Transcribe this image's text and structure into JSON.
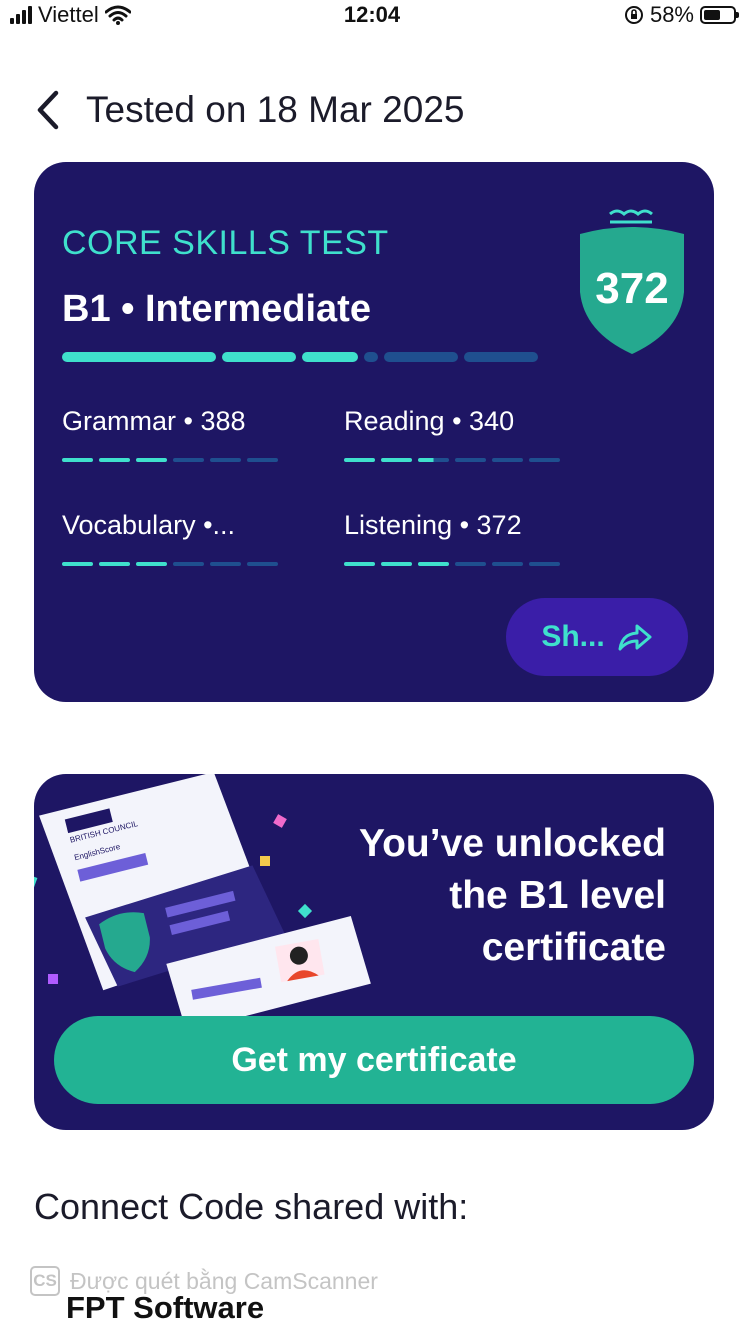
{
  "status_bar": {
    "carrier": "Viettel",
    "time": "12:04",
    "battery_percent": "58%",
    "battery_level": 0.58,
    "icons": [
      "signal-icon",
      "wifi-icon",
      "rotation-lock-icon",
      "battery-icon"
    ]
  },
  "header": {
    "back_icon": "chevron-left-icon",
    "title": "Tested on 18 Mar 2025"
  },
  "result_card": {
    "test_name": "CORE SKILLS TEST",
    "level": "B1 • Intermediate",
    "overall_score": "372",
    "progress_segments_filled": 3,
    "progress_segments_total": 6,
    "skills": [
      {
        "label": "Grammar • 388",
        "segments_filled": 3,
        "segments_total": 6
      },
      {
        "label": "Reading • 340",
        "segments_filled": 2.5,
        "segments_total": 6
      },
      {
        "label": "Vocabulary •...",
        "segments_filled": 3,
        "segments_total": 6
      },
      {
        "label": "Listening • 372",
        "segments_filled": 3,
        "segments_total": 6
      }
    ],
    "share_label": "Sh...",
    "share_icon": "share-arrow-icon"
  },
  "certificate_card": {
    "message_line1": "You’ve unlocked",
    "message_line2": "the B1 level",
    "message_line3": "certificate",
    "illustration_text": "BRITISH COUNCIL",
    "illustration_subtext": "EnglishScore",
    "button_label": "Get my certificate"
  },
  "connect": {
    "heading": "Connect Code shared with:",
    "company": "FPT Software"
  },
  "watermark": {
    "logo": "CS",
    "text": "Được quét bằng CamScanner"
  },
  "colors": {
    "card_bg": "#1e1664",
    "accent_teal": "#3fe0cc",
    "bar_inactive": "#1f4f8f",
    "button_green": "#22b394",
    "share_button": "#3a1ea8"
  }
}
